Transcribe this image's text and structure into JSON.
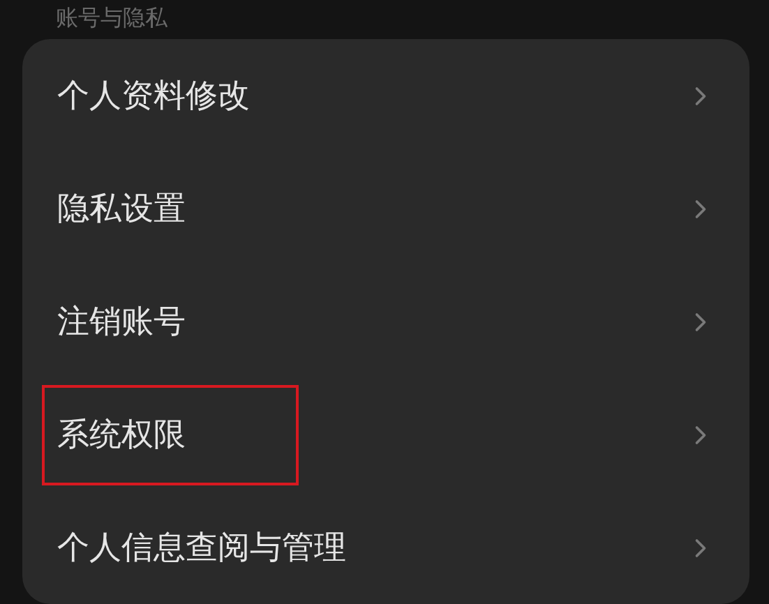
{
  "section_title": "账号与隐私",
  "items": [
    {
      "label": "个人资料修改",
      "highlighted": false
    },
    {
      "label": "隐私设置",
      "highlighted": false
    },
    {
      "label": "注销账号",
      "highlighted": false
    },
    {
      "label": "系统权限",
      "highlighted": true
    },
    {
      "label": "个人信息查阅与管理",
      "highlighted": false
    }
  ]
}
